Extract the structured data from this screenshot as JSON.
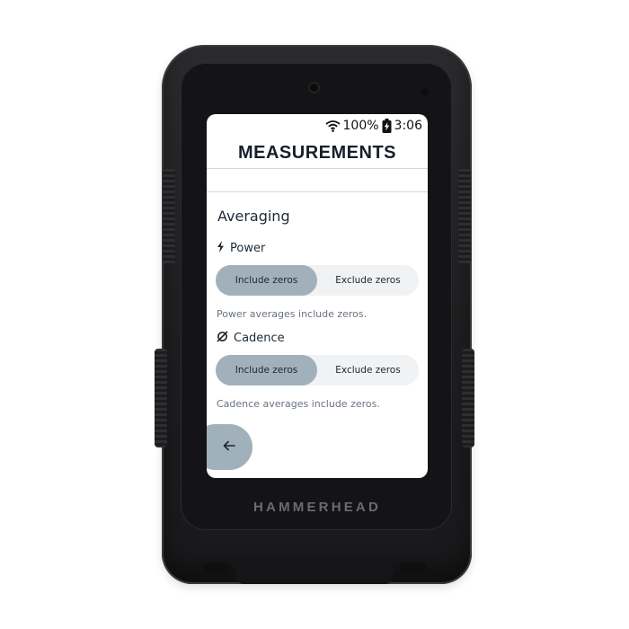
{
  "status_bar": {
    "battery": "100%",
    "time": "3:06",
    "icons": [
      "wifi-icon",
      "battery-charging-icon"
    ]
  },
  "header": {
    "title": "MEASUREMENTS"
  },
  "averaging": {
    "title": "Averaging",
    "power": {
      "label": "Power",
      "icon": "lightning-bolt-icon",
      "options": [
        "Include zeros",
        "Exclude zeros"
      ],
      "selected": "Include zeros",
      "description": "Power averages include zeros."
    },
    "cadence": {
      "label": "Cadence",
      "icon": "cadence-slash-circle-icon",
      "options": [
        "Include zeros",
        "Exclude zeros"
      ],
      "selected": "Include zeros",
      "description": "Cadence averages include zeros."
    }
  },
  "navigation": {
    "back_icon": "arrow-left-icon"
  },
  "device": {
    "brand": "HAMMERHEAD"
  },
  "colors": {
    "accent": "#a1b1bc",
    "segment_bg": "#f1f2f3",
    "device_body": "#1e1e20",
    "text_primary": "#1e2a35",
    "text_secondary": "#6a7480"
  }
}
